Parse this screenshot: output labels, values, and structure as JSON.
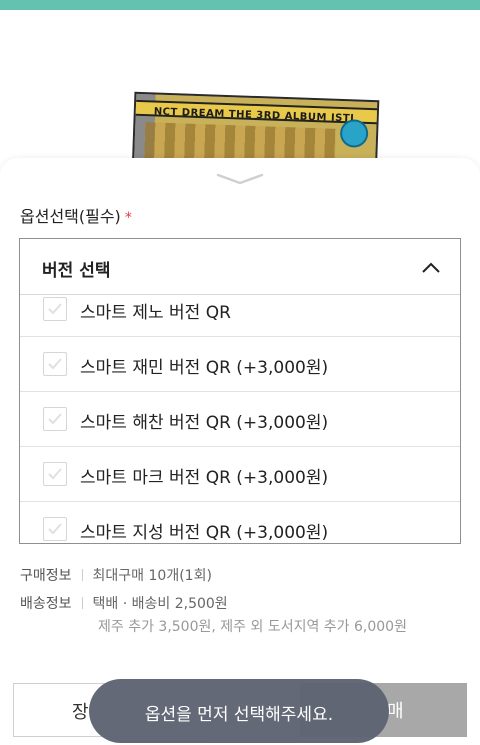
{
  "product": {
    "album_text": "NCT DREAM THE 3RD ALBUM ISTJ"
  },
  "option": {
    "label": "옵션선택(필수)",
    "required_mark": "*",
    "select_title": "버전 선택",
    "items": [
      {
        "label": "스마트 제노 버전 QR",
        "checked": false
      },
      {
        "label": "스마트 재민 버전 QR (+3,000원)",
        "checked": false
      },
      {
        "label": "스마트 해찬 버전 QR (+3,000원)",
        "checked": false
      },
      {
        "label": "스마트 마크 버전 QR (+3,000원)",
        "checked": false
      },
      {
        "label": "스마트 지성 버전 QR (+3,000원)",
        "checked": false
      }
    ]
  },
  "purchase_info": {
    "key": "구매정보",
    "value": "최대구매 10개(1회)"
  },
  "shipping_info": {
    "key": "배송정보",
    "value": "택배 · 배송비 2,500원",
    "extra": "제주 추가 3,500원, 제주 외 도서지역 추가 6,000원"
  },
  "buttons": {
    "cart_partial": "장",
    "buy_partial": "매"
  },
  "toast": {
    "message": "옵션을 먼저 선택해주세요."
  },
  "colors": {
    "top_bar": "#64c2b0",
    "required": "#e23a3a",
    "toast_bg": "#5e6473",
    "buy_button": "#a8a8a8"
  }
}
